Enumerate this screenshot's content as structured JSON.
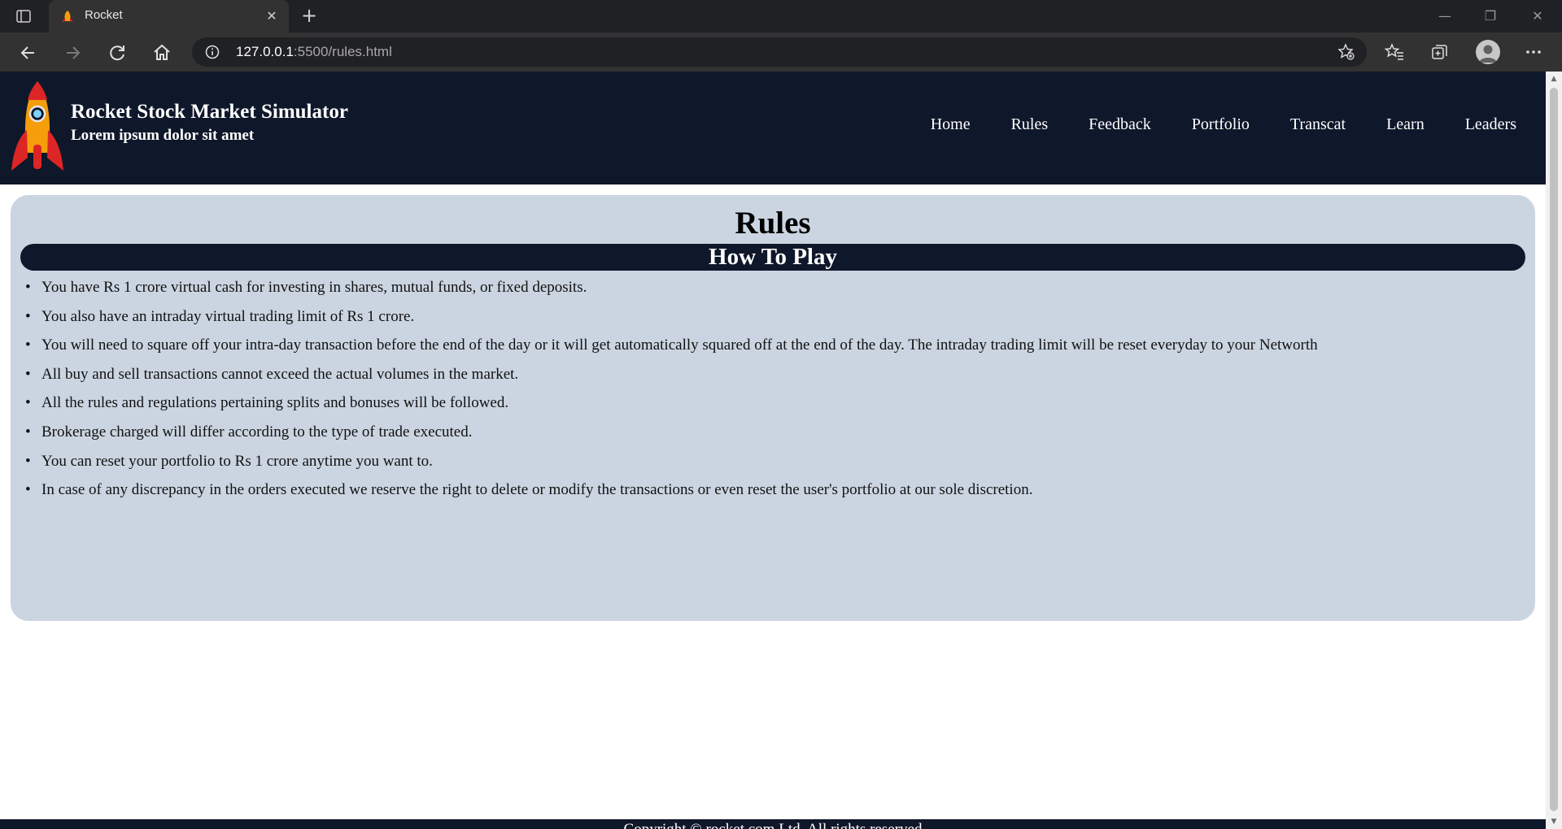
{
  "browser": {
    "tab_title": "Rocket",
    "tab_close": "✕",
    "new_tab": "+",
    "url_host": "127.0.0.1",
    "url_path": ":5500/rules.html",
    "window_controls": {
      "minimize": "—",
      "restore": "❐",
      "close": "✕"
    },
    "icons": [
      "tab-actions-icon",
      "rocket-favicon-icon",
      "back-icon",
      "forward-icon",
      "refresh-icon",
      "home-icon",
      "site-info-icon",
      "add-favorite-icon",
      "favorites-icon",
      "collections-icon",
      "profile-icon",
      "more-icon"
    ]
  },
  "site": {
    "brand_title": "Rocket Stock Market Simulator",
    "brand_subtitle": "Lorem ipsum dolor sit amet",
    "nav": [
      "Home",
      "Rules",
      "Feedback",
      "Portfolio",
      "Transcat",
      "Learn",
      "Leaders"
    ],
    "colors": {
      "header_bg": "#0f172a",
      "card_bg": "#cbd5e1",
      "rocket_body": "#f59e0b",
      "rocket_fin": "#dc2626"
    }
  },
  "rules": {
    "title": "Rules",
    "subtitle": "How To Play",
    "items": [
      "You have Rs 1 crore virtual cash for investing in shares, mutual funds, or fixed deposits.",
      "You also have an intraday virtual trading limit of Rs 1 crore.",
      "You will need to square off your intra-day transaction before the end of the day or it will get automatically squared off at the end of the day. The intraday trading limit will be reset everyday to your Networth",
      "All buy and sell transactions cannot exceed the actual volumes in the market.",
      "All the rules and regulations pertaining splits and bonuses will be followed.",
      "Brokerage charged will differ according to the type of trade executed.",
      "You can reset your portfolio to Rs 1 crore anytime you want to.",
      "In case of any discrepancy in the orders executed we reserve the right to delete or modify the transactions or even reset the user's portfolio at our sole discretion."
    ]
  },
  "footer": {
    "text": "Copyright © rocket.com Ltd. All rights reserved"
  }
}
